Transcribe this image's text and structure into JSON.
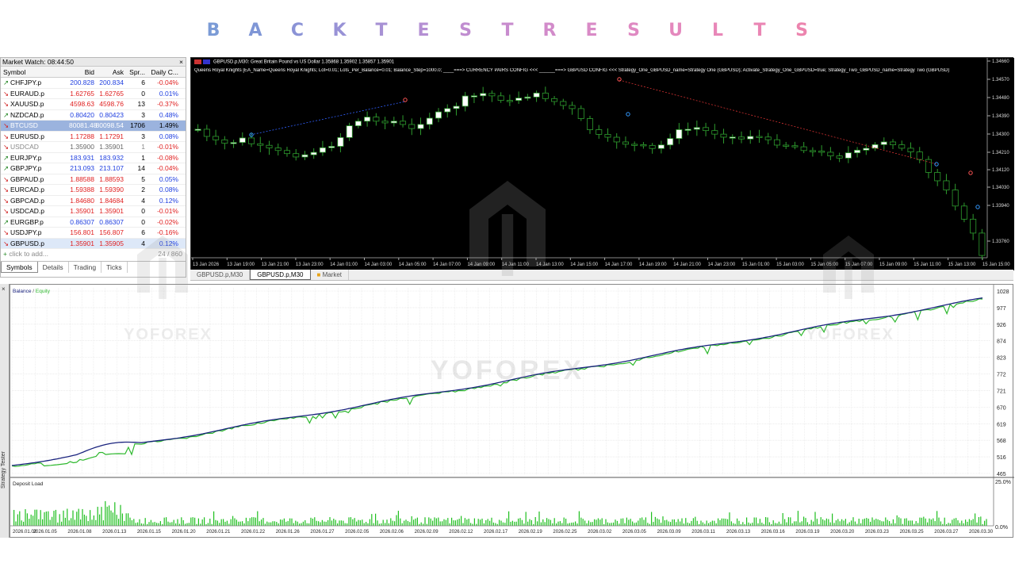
{
  "banner": {
    "letters": [
      "B",
      "A",
      "C",
      "K",
      "T",
      "E",
      "S",
      "T",
      "R",
      "E",
      "S",
      "U",
      "L",
      "T",
      "S"
    ],
    "colors": [
      "#7b9bd6",
      "#7f96d6",
      "#8b93d6",
      "#9892d6",
      "#a791d4",
      "#b48fd3",
      "#c08dd0",
      "#c88cce",
      "#d28bca",
      "#d98ac6",
      "#df89c2",
      "#e488bd",
      "#e887b8",
      "#ea86b4",
      "#ec84ae"
    ]
  },
  "market_watch": {
    "title": "Market Watch: 08:44:50",
    "close": "×",
    "headers": {
      "symbol": "Symbol",
      "bid": "Bid",
      "ask": "Ask",
      "spread": "Spr...",
      "change": "Daily C..."
    },
    "rows": [
      {
        "symbol": "CHFJPY.p",
        "bid": "200.828",
        "ask": "200.834",
        "spread": "6",
        "change": "-0.04%",
        "dir": "up",
        "cdir": "neg"
      },
      {
        "symbol": "EURAUD.p",
        "bid": "1.62765",
        "ask": "1.62765",
        "spread": "0",
        "change": "0.01%",
        "dir": "dn",
        "cdir": "pos"
      },
      {
        "symbol": "XAUUSD.p",
        "bid": "4598.63",
        "ask": "4598.76",
        "spread": "13",
        "change": "-0.37%",
        "dir": "dn",
        "cdir": "neg"
      },
      {
        "symbol": "NZDCAD.p",
        "bid": "0.80420",
        "ask": "0.80423",
        "spread": "3",
        "change": "0.48%",
        "dir": "up",
        "cdir": "pos"
      },
      {
        "symbol": "BTCUSD",
        "bid": "80081.48",
        "ask": "80098.54",
        "spread": "1706",
        "change": "1.49%",
        "dir": "dn",
        "cdir": "pos",
        "sel": true
      },
      {
        "symbol": "EURUSD.p",
        "bid": "1.17288",
        "ask": "1.17291",
        "spread": "3",
        "change": "0.08%",
        "dir": "dn",
        "cdir": "pos"
      },
      {
        "symbol": "USDCAD",
        "bid": "1.35900",
        "ask": "1.35901",
        "spread": "1",
        "change": "-0.01%",
        "dir": "dn",
        "cdir": "neg",
        "gray": true
      },
      {
        "symbol": "EURJPY.p",
        "bid": "183.931",
        "ask": "183.932",
        "spread": "1",
        "change": "-0.08%",
        "dir": "up",
        "cdir": "neg"
      },
      {
        "symbol": "GBPJPY.p",
        "bid": "213.093",
        "ask": "213.107",
        "spread": "14",
        "change": "-0.04%",
        "dir": "up",
        "cdir": "neg"
      },
      {
        "symbol": "GBPAUD.p",
        "bid": "1.88588",
        "ask": "1.88593",
        "spread": "5",
        "change": "0.05%",
        "dir": "dn",
        "cdir": "pos"
      },
      {
        "symbol": "EURCAD.p",
        "bid": "1.59388",
        "ask": "1.59390",
        "spread": "2",
        "change": "0.08%",
        "dir": "dn",
        "cdir": "pos"
      },
      {
        "symbol": "GBPCAD.p",
        "bid": "1.84680",
        "ask": "1.84684",
        "spread": "4",
        "change": "0.12%",
        "dir": "dn",
        "cdir": "pos"
      },
      {
        "symbol": "USDCAD.p",
        "bid": "1.35901",
        "ask": "1.35901",
        "spread": "0",
        "change": "-0.01%",
        "dir": "dn",
        "cdir": "neg"
      },
      {
        "symbol": "EURGBP.p",
        "bid": "0.86307",
        "ask": "0.86307",
        "spread": "0",
        "change": "-0.02%",
        "dir": "up",
        "cdir": "neg"
      },
      {
        "symbol": "USDJPY.p",
        "bid": "156.801",
        "ask": "156.807",
        "spread": "6",
        "change": "-0.16%",
        "dir": "dn",
        "cdir": "neg"
      },
      {
        "symbol": "GBPUSD.p",
        "bid": "1.35901",
        "ask": "1.35905",
        "spread": "4",
        "change": "0.12%",
        "dir": "dn",
        "cdir": "pos",
        "sel2": true
      }
    ],
    "add_label": "click to add...",
    "count": "24 / 860",
    "tabs": [
      "Symbols",
      "Details",
      "Trading",
      "Ticks"
    ],
    "active_tab": "Symbols"
  },
  "price_chart": {
    "info": "GBPUSD.p,M30:  Great Britain Pound vs US Dollar  1.35868 1.35902 1.35857 1.35901",
    "params": "Queens Royal Knights [EA_Name=Queens Royal Knights; Lot=0.01; Lots_Per_Balance=0.01; Balance_Step=1000.0; ____===> CURRENCY PAIRS CONFIG <<< ______===> GBPUSD CONFIG <<< Strategy_One_GBPUSD_name=Strategy One (GBPUSD); Activate_Strategy_One_GBPUSD=true; Strategy_Two_GBPUSD_name=Strategy Two (GBPUSD)",
    "price_labels": [
      "1.34660",
      "1.34570",
      "1.34480",
      "1.34390",
      "1.34300",
      "1.34210",
      "1.34120",
      "1.34030",
      "1.33940",
      "1.33760"
    ],
    "time_labels": [
      "13 Jan 2026",
      "13 Jan 19:00",
      "13 Jan 21:00",
      "13 Jan 23:00",
      "14 Jan 01:00",
      "14 Jan 03:00",
      "14 Jan 05:00",
      "14 Jan 07:00",
      "14 Jan 09:00",
      "14 Jan 11:00",
      "14 Jan 13:00",
      "14 Jan 15:00",
      "14 Jan 17:00",
      "14 Jan 19:00",
      "14 Jan 21:00",
      "14 Jan 23:00",
      "15 Jan 01:00",
      "15 Jan 03:00",
      "15 Jan 05:00",
      "15 Jan 07:00",
      "15 Jan 09:00",
      "15 Jan 11:00",
      "15 Jan 13:00",
      "15 Jan 15:00"
    ]
  },
  "chart_tabs": [
    "GBPUSD.p,M30",
    "GBPUSD.p,M30",
    "Market"
  ],
  "tester": {
    "legend_balance": "Balance",
    "legend_sep": " / ",
    "legend_equity": "Equity",
    "deposit_label": "Deposit Load",
    "side_label": "Strategy Tester",
    "close": "×",
    "colors": {
      "balance": "#1a237e",
      "equity": "#2eb82e",
      "deposit": "#1fbf1f"
    },
    "y_labels": [
      "1028",
      "977",
      "926",
      "874",
      "823",
      "772",
      "721",
      "670",
      "619",
      "568",
      "516",
      "465"
    ],
    "deposit_labels": [
      "25.0%",
      "0.0%"
    ],
    "date_labels": [
      "2026.01.02",
      "2026.01.05",
      "2026.01.08",
      "2026.01.13",
      "2026.01.15",
      "2026.01.20",
      "2026.01.21",
      "2026.01.22",
      "2026.01.26",
      "2026.01.27",
      "2026.02.05",
      "2026.02.06",
      "2026.02.09",
      "2026.02.12",
      "2026.02.17",
      "2026.02.19",
      "2026.02.25",
      "2026.03.02",
      "2026.03.05",
      "2026.03.09",
      "2026.03.11",
      "2026.03.13",
      "2026.03.16",
      "2026.03.19",
      "2026.03.20",
      "2026.03.23",
      "2026.03.25",
      "2026.03.27",
      "2026.03.30"
    ]
  },
  "watermark": "YOFOREX"
}
